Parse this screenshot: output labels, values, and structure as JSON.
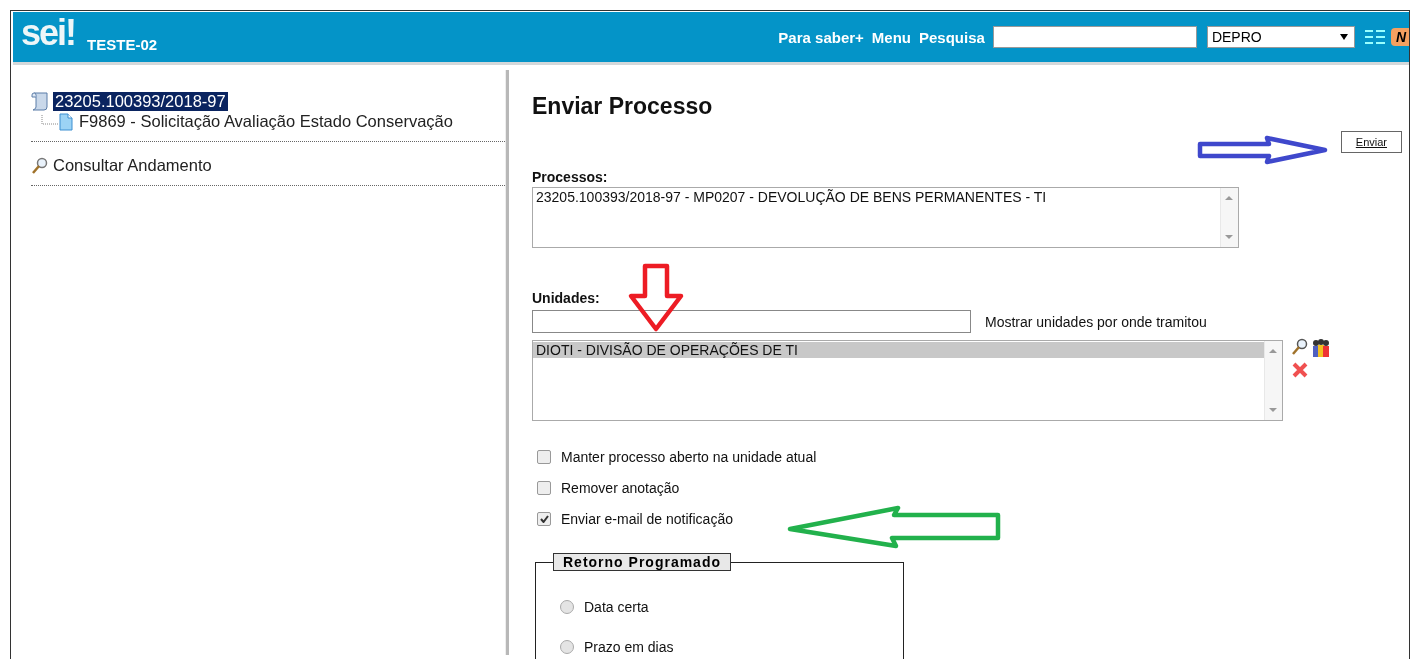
{
  "header": {
    "logo": "sei!",
    "unit": "TESTE-02",
    "links": [
      "Para saber+",
      "Menu",
      "Pesquisa"
    ],
    "unit_select": {
      "value": "DEPRO"
    },
    "badge": "N"
  },
  "tree": {
    "label": "23205.100393/2018-97",
    "selected": true,
    "children": [
      {
        "label": "F9869 - Solicitação Avaliação Estado Conservação",
        "selected": false
      }
    ]
  },
  "sidebar_links": [
    "Consultar Andamento"
  ],
  "form": {
    "title": "Enviar Processo",
    "submit": {
      "label": "Enviar",
      "arrow": {
        "kind": "right",
        "color": "#3f48cc"
      }
    },
    "processos": {
      "label": "Processos:",
      "items": [
        "23205.100393/2018-97 - MP0207 - DEVOLUÇÃO DE BENS PERMANENTES - TI"
      ]
    },
    "unidades": {
      "label": "Unidades:",
      "arrow": {
        "kind": "down",
        "color": "#ed1c24"
      },
      "link": "Mostrar unidades por onde tramitou",
      "items": [
        {
          "text": "DIOTI - DIVISÃO DE OPERAÇÕES DE TI",
          "selected": true
        }
      ]
    },
    "options": [
      {
        "label": "Manter processo aberto na unidade atual",
        "checked": false
      },
      {
        "label": "Remover anotação",
        "checked": false
      },
      {
        "label": "Enviar e-mail de notificação",
        "checked": true,
        "arrow": {
          "kind": "left",
          "color": "#22b14c"
        }
      }
    ],
    "retorno": {
      "legend": "Retorno Programado",
      "options": [
        {
          "label": "Data certa",
          "selected": false
        },
        {
          "label": "Prazo em dias",
          "selected": false
        }
      ]
    }
  }
}
